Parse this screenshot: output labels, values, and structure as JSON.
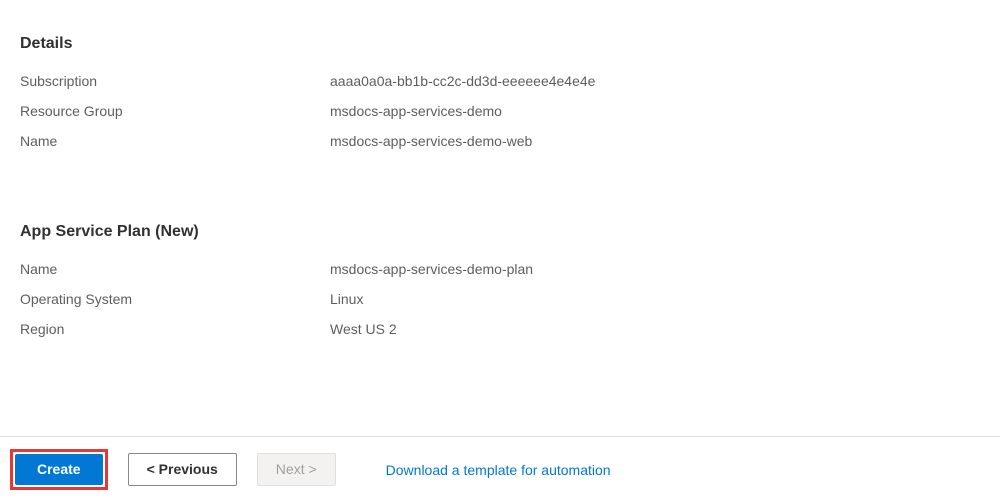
{
  "details": {
    "heading": "Details",
    "rows": [
      {
        "label": "Subscription",
        "value": "aaaa0a0a-bb1b-cc2c-dd3d-eeeeee4e4e4e"
      },
      {
        "label": "Resource Group",
        "value": "msdocs-app-services-demo"
      },
      {
        "label": "Name",
        "value": "msdocs-app-services-demo-web"
      }
    ]
  },
  "appServicePlan": {
    "heading": "App Service Plan (New)",
    "rows": [
      {
        "label": "Name",
        "value": "msdocs-app-services-demo-plan"
      },
      {
        "label": "Operating System",
        "value": "Linux"
      },
      {
        "label": "Region",
        "value": "West US 2"
      }
    ]
  },
  "footer": {
    "create": "Create",
    "previous": "< Previous",
    "next": "Next >",
    "downloadLink": "Download a template for automation"
  }
}
